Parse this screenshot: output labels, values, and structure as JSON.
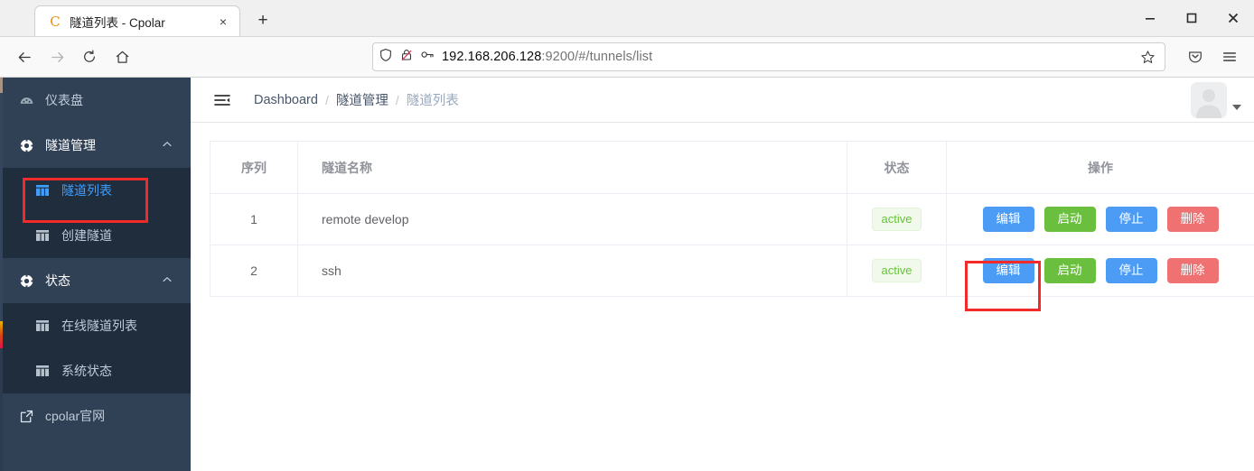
{
  "browser": {
    "tab": {
      "favicon_letter": "C",
      "title": "隧道列表 - Cpolar",
      "close_label": "×"
    },
    "new_tab_label": "+",
    "window_controls": {
      "minimize": "—",
      "maximize": "□",
      "close": "✕"
    },
    "nav": {
      "back": "back-arrow",
      "forward": "forward-arrow",
      "reload": "reload",
      "home": "home"
    },
    "url": {
      "host": "192.168.206.128",
      "rest": ":9200/#/tunnels/list"
    },
    "icons": {
      "shield": "shield-icon",
      "lock_broken": "broken-lock-icon",
      "key": "key-icon",
      "bookmark": "star-icon",
      "pocket": "pocket-icon",
      "menu": "hamburger-menu-icon"
    }
  },
  "sidebar": {
    "items": [
      {
        "label": "仪表盘",
        "icon": "dashboard-icon",
        "type": "item"
      },
      {
        "label": "隧道管理",
        "icon": "compass-icon",
        "type": "group",
        "expanded": true
      },
      {
        "label": "隧道列表",
        "icon": "table-icon",
        "type": "sub",
        "active": true
      },
      {
        "label": "创建隧道",
        "icon": "table-icon",
        "type": "sub",
        "active": false
      },
      {
        "label": "状态",
        "icon": "compass-icon",
        "type": "group",
        "expanded": true
      },
      {
        "label": "在线隧道列表",
        "icon": "table-icon",
        "type": "sub",
        "active": false
      },
      {
        "label": "系统状态",
        "icon": "table-icon",
        "type": "sub",
        "active": false
      },
      {
        "label": "cpolar官网",
        "icon": "external-link-icon",
        "type": "bottom"
      }
    ]
  },
  "topbar": {
    "collapse_icon": "collapse-menu-icon",
    "breadcrumb": [
      {
        "label": "Dashboard",
        "muted": false
      },
      {
        "label": "隧道管理",
        "muted": false
      },
      {
        "label": "隧道列表",
        "muted": true
      }
    ],
    "separator": "/",
    "avatar": "user-avatar"
  },
  "table": {
    "headers": {
      "index": "序列",
      "name": "隧道名称",
      "state": "状态",
      "ops": "操作"
    },
    "rows": [
      {
        "index": "1",
        "name": "remote develop",
        "state": "active",
        "ops": [
          {
            "label": "编辑",
            "style": "primary"
          },
          {
            "label": "启动",
            "style": "success"
          },
          {
            "label": "停止",
            "style": "primary"
          },
          {
            "label": "删除",
            "style": "danger"
          }
        ]
      },
      {
        "index": "2",
        "name": "ssh",
        "state": "active",
        "ops": [
          {
            "label": "编辑",
            "style": "primary"
          },
          {
            "label": "启动",
            "style": "success"
          },
          {
            "label": "停止",
            "style": "primary"
          },
          {
            "label": "删除",
            "style": "danger"
          }
        ]
      }
    ]
  },
  "colors": {
    "sidebar_bg": "#304156",
    "sidebar_sub_bg": "#1f2d3d",
    "accent_blue": "#409EFF",
    "button_primary": "#4c9cf5",
    "button_success": "#6abf3f",
    "button_danger": "#f07171",
    "tag_green_text": "#67c23a",
    "tag_green_bg": "#f0f9eb",
    "highlight_red": "#f32a2a"
  },
  "annotations": [
    {
      "name": "sidebar-tunnel-list-highlight",
      "target": "隧道列表"
    },
    {
      "name": "edit-button-highlight",
      "target": "编辑"
    }
  ]
}
